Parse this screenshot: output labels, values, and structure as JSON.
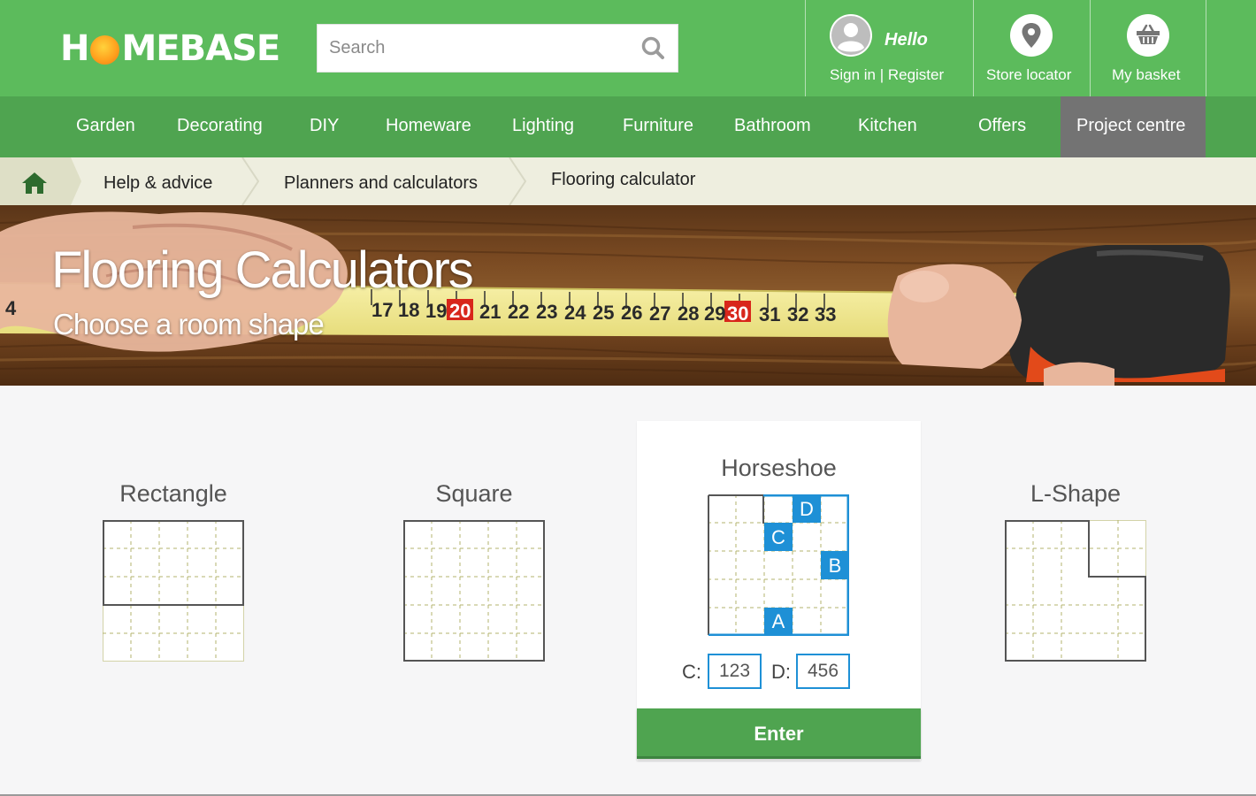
{
  "brand": {
    "logo_left": "H",
    "logo_right": "MEBASE"
  },
  "search": {
    "placeholder": "Search"
  },
  "account": {
    "greeting": "Hello",
    "link": "Sign in | Register"
  },
  "store_locator": {
    "label": "Store locator"
  },
  "basket": {
    "label": "My basket"
  },
  "nav": {
    "items": [
      {
        "label": "Garden"
      },
      {
        "label": "Decorating"
      },
      {
        "label": "DIY"
      },
      {
        "label": "Homeware"
      },
      {
        "label": "Lighting"
      },
      {
        "label": "Furniture"
      },
      {
        "label": "Bathroom"
      },
      {
        "label": "Kitchen"
      },
      {
        "label": "Offers"
      },
      {
        "label": "Project centre",
        "active": true
      }
    ]
  },
  "breadcrumb": {
    "items": [
      "Help & advice",
      "Planners and calculators",
      "Flooring calculator"
    ]
  },
  "hero": {
    "title": "Flooring Calculators",
    "subtitle": "Choose a room shape",
    "tape_numbers": [
      "4",
      "17",
      "18",
      "19",
      "20",
      "21",
      "22",
      "23",
      "24",
      "25",
      "26",
      "27",
      "28",
      "29",
      "30",
      "31",
      "32",
      "33"
    ]
  },
  "shapes": {
    "rectangle": {
      "title": "Rectangle"
    },
    "square": {
      "title": "Square"
    },
    "horseshoe": {
      "title": "Horseshoe",
      "markers": [
        "A",
        "B",
        "C",
        "D"
      ],
      "selected": true,
      "inputs": [
        {
          "label": "C:",
          "value": "123"
        },
        {
          "label": "D:",
          "value": "456"
        }
      ],
      "enter_label": "Enter"
    },
    "lshape": {
      "title": "L-Shape"
    }
  },
  "colors": {
    "header_green": "#5cbb5c",
    "nav_green": "#4fa450",
    "active_nav": "#737373",
    "breadcrumb_bg": "#eeeedf",
    "accent_blue": "#1e90d6",
    "grid_dash": "#b3b36c"
  }
}
